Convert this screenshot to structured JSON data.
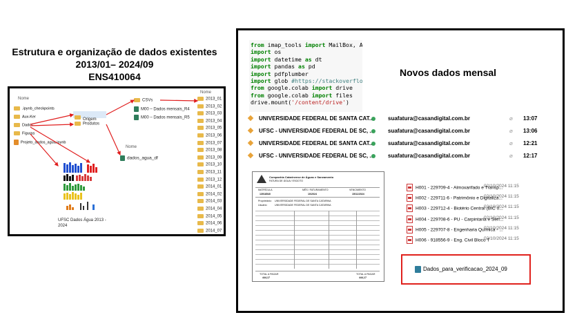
{
  "left": {
    "title_line1": "Estrutura e organização de dados existentes",
    "title_line2": "2013/01– 2024/09",
    "title_line3": "ENS410064",
    "explorer": {
      "header": "Nome",
      "tree": [
        ".ipynb_checkpoints",
        "Aux-Ker",
        "Dados",
        "Figuras",
        "Projeto_dados_agua.ipynb"
      ],
      "sub": [
        "Origem",
        "Produtos"
      ],
      "csv_header": "CSVs",
      "csv_files": [
        "M00 – Dados mensais_R4",
        "M00 – Dados mensais_R5"
      ],
      "produtos_header": "Nome",
      "produtos_file": "dados_agua_df",
      "months_header": "Nome",
      "months": [
        "2013_01",
        "2013_02",
        "2013_03",
        "2013_04",
        "2013_05",
        "2013_06",
        "2013_07",
        "2013_08",
        "2013_09",
        "2013_10",
        "2013_11",
        "2013_12",
        "2014_01",
        "2014_02",
        "2014_03",
        "2014_04",
        "2014_05",
        "2014_06",
        "2014_07"
      ],
      "caption_line1": "UFSC Dados Água 2013 -",
      "caption_line2": "2024"
    }
  },
  "right": {
    "code": [
      {
        "k": "from",
        "t": " imap_tools ",
        "k2": "import",
        "t2": " MailBox, AND, A"
      },
      {
        "k": "import",
        "t": " os"
      },
      {
        "k": "import",
        "t": " datetime ",
        "k2": "as",
        "t2": " dt"
      },
      {
        "k": "import",
        "t": " pandas ",
        "k2": "as",
        "t2": " pd"
      },
      {
        "k": "import",
        "t": " pdfplumber"
      },
      {
        "k": "import",
        "t": " glob ",
        "c": "#https://stackoverflow.com/"
      },
      {
        "k": "from",
        "t": " google.colab ",
        "k2": "import",
        "t2": " drive"
      },
      {
        "k": "from",
        "t": " google.colab ",
        "k2": "import",
        "t2": " files"
      },
      {
        "t": "drive.mount(",
        "s": "'/content/drive'",
        "t2": ")"
      }
    ],
    "title": "Novos dados mensal",
    "emails": [
      {
        "subject": "UNIVERSIDADE FEDERAL DE SANTA CAT...",
        "from": "suafatura@casandigital.com.br",
        "time": "13:07"
      },
      {
        "subject": "UFSC - UNIVERSIDADE FEDERAL DE SC, ...",
        "from": "suafatura@casandigital.com.br",
        "time": "13:06"
      },
      {
        "subject": "UNIVERSIDADE FEDERAL DE SANTA CAT...",
        "from": "suafatura@casandigital.com.br",
        "time": "12:21"
      },
      {
        "subject": "UFSC - UNIVERSIDADE FEDERAL DE SC, ...",
        "from": "suafatura@casandigital.com.br",
        "time": "12:17"
      }
    ],
    "invoice": {
      "company": "Companhia Catarinense de Águas e Saneamento",
      "doc": "FATURA DE ÁGUA / ESGOTO",
      "matricula_label": "MATRÍCULA",
      "mes_label": "MÊS / FATURAMENTO",
      "venc_label": "VENCIMENTO",
      "matricula": "13918540",
      "mes": "10/2024",
      "venc": "15/11/2024",
      "owner_label": "Proprietário:",
      "owner": "UNIVERSIDADE FEDERAL DE SANTA CATARINA",
      "user_label": "Usuário:",
      "user": "UNIVERSIDADE FEDERAL DE SANTA CATARINA",
      "total_label": "TOTAL A PAGAR",
      "total": "444,17"
    },
    "pdf_files": [
      {
        "name": "H001 - 229709-4 - Almoxarifado e Transp...",
        "date": "02/10/2024 11:15"
      },
      {
        "name": "H002 - 229711-6 - Patrimônio e Digitaliza...",
        "date": "02/10/2024 11:15"
      },
      {
        "name": "H003 - 229712-4 - Biotério Central (BIC 0...",
        "date": "02/10/2024 11:15"
      },
      {
        "name": "H004 - 229708-6 - PU - Carpintaria e Serr...",
        "date": "02/10/2024 11:15"
      },
      {
        "name": "H005 - 229707-8 - Engenharia Química - ...",
        "date": "02/10/2024 11:15"
      },
      {
        "name": "H006 - 918556-9 - Eng. Civil Bloco T",
        "date": "02/10/2024 11:15"
      }
    ],
    "highlight_file": "Dados_para_verificacao_2024_09"
  }
}
